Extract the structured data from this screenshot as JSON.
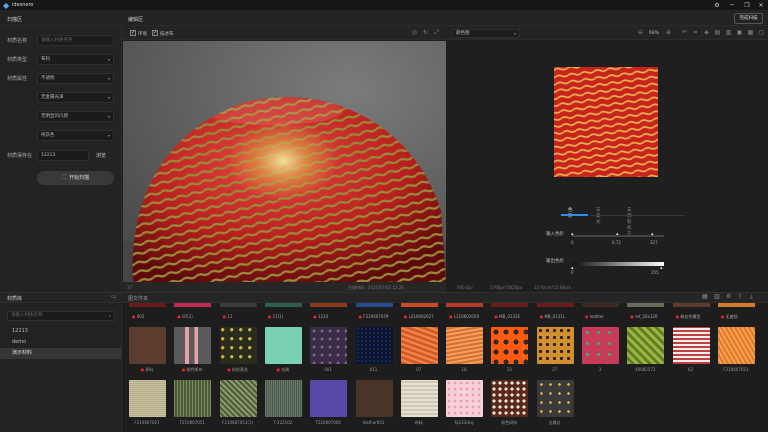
{
  "app": {
    "name": "idesnero"
  },
  "window": {
    "settings": "⚙",
    "minimize": "─",
    "maximize": "❐",
    "close": "✕"
  },
  "header": {
    "left_title": "扫描区",
    "center_title": "编辑区",
    "complete_button": "完成扫描"
  },
  "properties": {
    "rows": [
      {
        "label": "材质名称",
        "value": "",
        "placeholder": "请输入材质名称"
      },
      {
        "label": "材质类型",
        "value": "布料"
      },
      {
        "label": "材质属性",
        "value": "不透明"
      },
      {
        "label": "",
        "value": "无金属光泽"
      },
      {
        "label": "",
        "value": "无明显凹凸感"
      },
      {
        "label": "",
        "value": "纯灰色"
      },
      {
        "label": "材质保存在",
        "value": "12213",
        "action": "浏览"
      }
    ],
    "scan_button": "开始扫描"
  },
  "editor_toolbar": {
    "checkbox_env": "环境",
    "checkbox_bg": "描述布",
    "map_select": "颜色图",
    "zoom": "68%"
  },
  "viewport_status": {
    "left": "37",
    "scan_time": "扫描时间：2021/07/02 12:26",
    "dpi": "600 Dpi",
    "size_px": "3760px*3620px",
    "size_cm": "15.92cm*15.88cm"
  },
  "adjust": {
    "tabs": [
      "色阶",
      "去高光",
      "去阴影校正"
    ],
    "input_label": "输入色阶",
    "input_values": [
      "0",
      "0.72",
      "327"
    ],
    "output_label": "输出色阶",
    "output_values": [
      "0",
      "255"
    ]
  },
  "library": {
    "title": "材质库",
    "search_placeholder": "请输入材质名称",
    "items": [
      "12213",
      "demo",
      "演示材料"
    ],
    "selected_index": 2
  },
  "gallery": {
    "title": "图文件夹",
    "top_labels": [
      "002",
      "07(1)",
      "11",
      "11(1)",
      "1224",
      "F210607079",
      "L210602027",
      "L210602059",
      "MB_0131E",
      "MB_0131L",
      "leather",
      "mf_20x120",
      "粉丝色模型",
      "无遮挡"
    ],
    "row1": [
      "原料",
      "粉色帆布",
      "粉纹黄金",
      "金属",
      "001",
      "011",
      "07",
      "18",
      "23",
      "27",
      "3",
      "40082573",
      "62",
      "F210607021"
    ],
    "row2": [
      "F210607027",
      "F210607051",
      "F210607051(1)",
      "T-222102",
      "T210607006",
      "leather001",
      "布料",
      "标123dsg",
      "粉色网布",
      "金属丝"
    ]
  },
  "colors": {
    "accent": "#2d8cf0",
    "panel": "#232323",
    "red_dot": "#e02a3a"
  }
}
